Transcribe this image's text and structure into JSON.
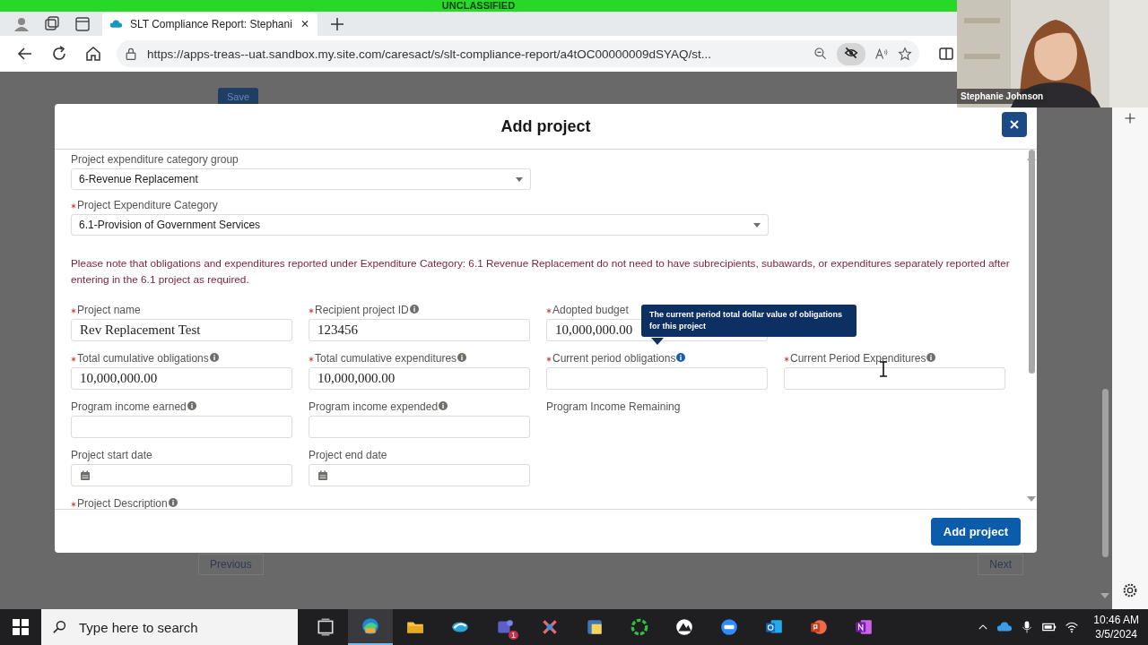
{
  "classification_banner": "UNCLASSIFIED",
  "browser": {
    "tabs": [
      {
        "title": "SLT Compliance Report: Stephani",
        "selected": true
      }
    ],
    "url": "https://apps-treas--uat.sandbox.my.site.com/caresact/s/slt-compliance-report/a4tOC00000009dSYAQ/st..."
  },
  "video": {
    "participant": "Stephanie Johnson"
  },
  "page": {
    "save_button": "Save",
    "previous_button": "Previous",
    "next_button": "Next"
  },
  "modal": {
    "title": "Add project",
    "selects": [
      {
        "label": "Project expenditure category group",
        "required": false,
        "value": "6-Revenue Replacement"
      },
      {
        "label": "Project Expenditure Category",
        "required": true,
        "value": "6.1-Provision of Government Services"
      }
    ],
    "notice": "Please note that obligations and expenditures reported under Expenditure Category: 6.1 Revenue Replacement do not need to have subrecipients, subawards, or expenditures separately reported after entering in the 6.1 project as required.",
    "rows": [
      [
        {
          "kind": "text",
          "label": "Project name",
          "required": true,
          "info": false,
          "value": "Rev Replacement Test"
        },
        {
          "kind": "text",
          "label": "Recipient project ID",
          "required": true,
          "info": true,
          "value": "123456"
        },
        {
          "kind": "text",
          "label": "Adopted budget",
          "required": true,
          "info": false,
          "value": "10,000,000.00"
        }
      ],
      [
        {
          "kind": "text",
          "label": "Total cumulative obligations",
          "required": true,
          "info": true,
          "value": "10,000,000.00"
        },
        {
          "kind": "text",
          "label": "Total cumulative expenditures",
          "required": true,
          "info": true,
          "value": "10,000,000.00"
        },
        {
          "kind": "text",
          "label": "Current period obligations",
          "required": true,
          "info": true,
          "tooltip": "The current period total dollar value of obligations for this project"
        },
        {
          "kind": "text",
          "label": "Current Period Expenditures",
          "required": true,
          "info": true
        }
      ],
      [
        {
          "kind": "text",
          "label": "Program income earned",
          "required": false,
          "info": true
        },
        {
          "kind": "text",
          "label": "Program income expended",
          "required": false,
          "info": true
        },
        {
          "kind": "static",
          "label": "Program Income Remaining",
          "required": false,
          "info": false
        }
      ],
      [
        {
          "kind": "date",
          "label": "Project start date",
          "required": false,
          "info": false
        },
        {
          "kind": "date",
          "label": "Project end date",
          "required": false,
          "info": false
        }
      ],
      [
        {
          "kind": "label",
          "label": "Project Description",
          "required": true,
          "info": true
        }
      ]
    ],
    "submit_button": "Add project"
  },
  "taskbar": {
    "search_placeholder": "Type here to search",
    "apps": [
      {
        "selected": false
      },
      {
        "selected": true
      },
      {
        "selected": false
      },
      {
        "selected": false
      },
      {
        "selected": false,
        "badge": "1"
      },
      {
        "selected": false
      },
      {
        "selected": false
      },
      {
        "selected": false
      },
      {
        "selected": false
      },
      {
        "selected": false
      },
      {
        "selected": false
      },
      {
        "selected": false
      },
      {
        "selected": false
      }
    ],
    "time": "10:46 AM",
    "date": "3/5/2024"
  }
}
